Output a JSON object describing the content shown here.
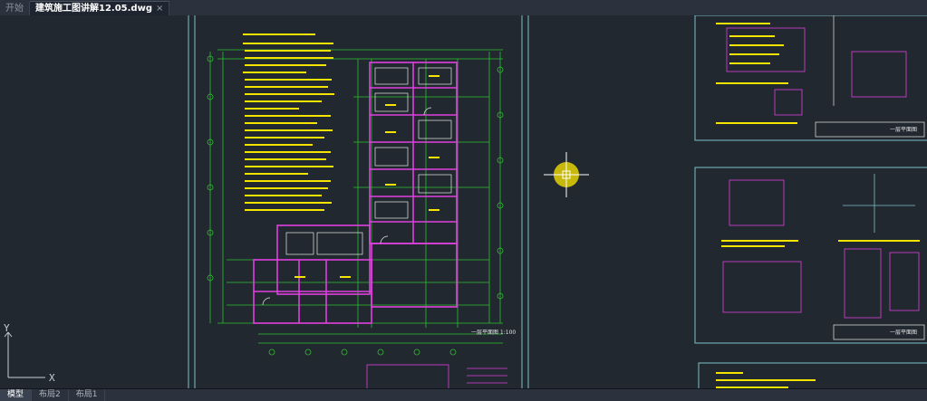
{
  "tabs": {
    "start_label": "开始",
    "active_label": "建筑施工图讲解12.05.dwg",
    "close_glyph": "×"
  },
  "drawing": {
    "floor_plan_title": "一层平面图 1:100",
    "detail_title_1": "一层平面图",
    "detail_title_2": "一层平面图"
  },
  "ucs": {
    "x_label": "X",
    "y_label": "Y"
  },
  "layout_tabs": [
    {
      "label": "模型",
      "active": true
    },
    {
      "label": "布局2",
      "active": false
    },
    {
      "label": "布局1",
      "active": false
    }
  ],
  "colors": {
    "background": "#212830",
    "frame_lines": "#7ec0c8",
    "text_yellow": "#f4e400",
    "green_grid": "#30c030",
    "magenta": "#e040e0",
    "white": "#e8e8e8",
    "cursor": "#ffe800"
  }
}
